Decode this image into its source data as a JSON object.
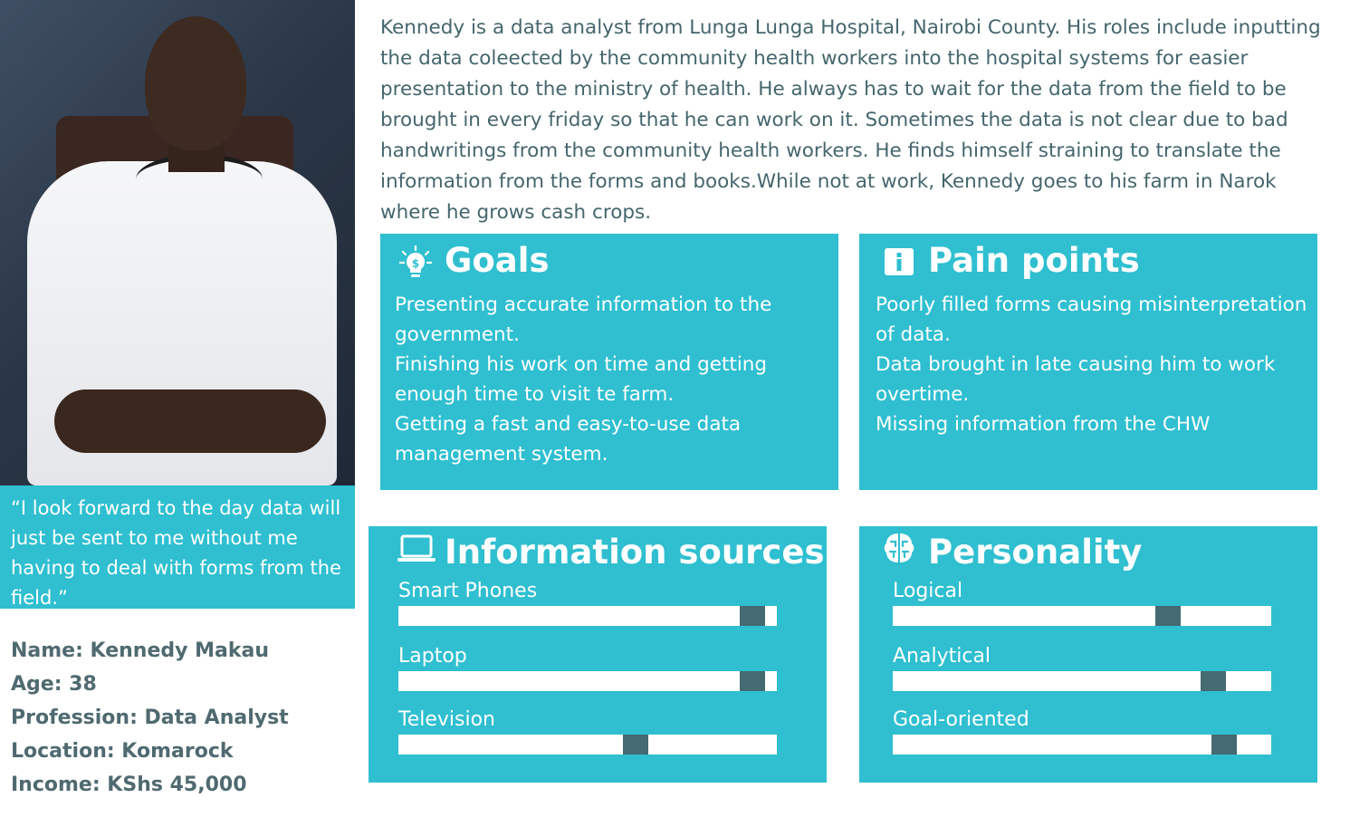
{
  "quote": "“I look forward to the day data will just be sent to me without me having to deal with forms from the field.”",
  "facts": [
    "Name: Kennedy Makau",
    "Age: 38",
    "Profession:  Data Analyst",
    "Location: Komarock",
    "Income: KShs 45,000"
  ],
  "bio": "Kennedy is a data analyst from Lunga Lunga Hospital, Nairobi County. His roles include inputting the data coleected by the community health workers into the hospital systems for easier presentation to the ministry of health. He always has to wait for the data from the field to be brought in every friday so that he can work on it. Sometimes the data is not clear due to bad handwritings from the community health workers. He finds himself straining to translate the information from the forms and books.While not at work, Kennedy goes to his farm in Narok where he grows cash crops.",
  "goals": {
    "title": "Goals",
    "icon": "lightbulb-dollar-icon",
    "items": [
      "Presenting accurate information to the government.",
      "Finishing his work on time and getting enough time to visit te farm.",
      "Getting a fast and easy-to-use data management system."
    ]
  },
  "pain_points": {
    "title": "Pain points",
    "icon": "info-icon",
    "items": [
      "Poorly filled forms causing misinterpretation of data.",
      "Data brought in late causing him to work overtime.",
      "Missing information from the CHW"
    ]
  },
  "information_sources": {
    "title": "Information sources",
    "icon": "laptop-icon",
    "items": [
      {
        "label": "Smart Phones",
        "level": 0.97
      },
      {
        "label": "Laptop",
        "level": 0.97
      },
      {
        "label": "Television",
        "level": 0.66
      }
    ]
  },
  "personality": {
    "title": "Personality",
    "icon": "brain-icon",
    "items": [
      {
        "label": "Logical",
        "level": 0.76
      },
      {
        "label": "Analytical",
        "level": 0.88
      },
      {
        "label": "Goal-oriented",
        "level": 0.91
      }
    ]
  },
  "colors": {
    "card": "#2fbfd0",
    "text": "#456a71",
    "knob": "#456a71"
  }
}
